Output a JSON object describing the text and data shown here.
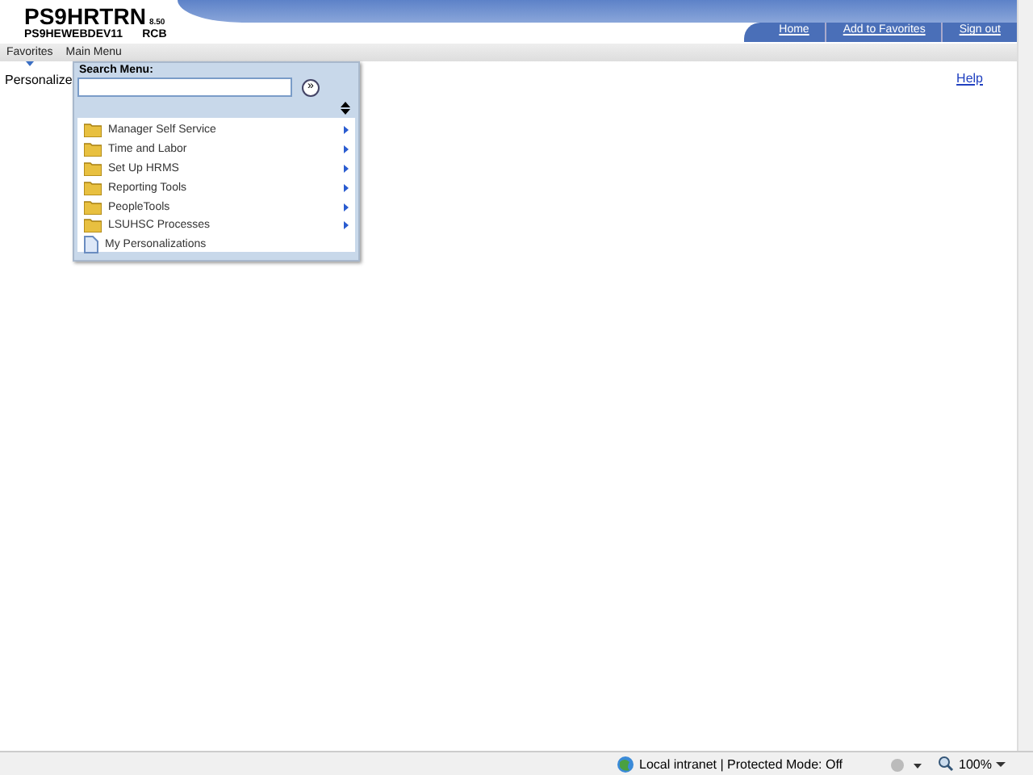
{
  "header": {
    "title": "PS9HRTRN",
    "version": "8.50",
    "server": "PS9HEWEBDEV11",
    "user": "RCB"
  },
  "header_links": [
    "Home",
    "Add to Favorites",
    "Sign out"
  ],
  "nav": [
    "Favorites",
    "Main Menu"
  ],
  "page": {
    "label": "Personalize",
    "help": "Help"
  },
  "menu": {
    "search_label": "Search Menu:",
    "go": "»",
    "items": [
      {
        "label": "Manager Self Service",
        "kind": "folder"
      },
      {
        "label": "Time and Labor",
        "kind": "folder"
      },
      {
        "label": "Set Up HRMS",
        "kind": "folder"
      },
      {
        "label": "Reporting Tools",
        "kind": "folder"
      },
      {
        "label": "PeopleTools",
        "kind": "folder"
      },
      {
        "label": "LSUHSC Processes",
        "kind": "folder"
      },
      {
        "label": "My Personalizations",
        "kind": "page"
      }
    ]
  },
  "status_bar": {
    "zone": "Local intranet | Protected Mode: Off",
    "zoom": "100%"
  }
}
